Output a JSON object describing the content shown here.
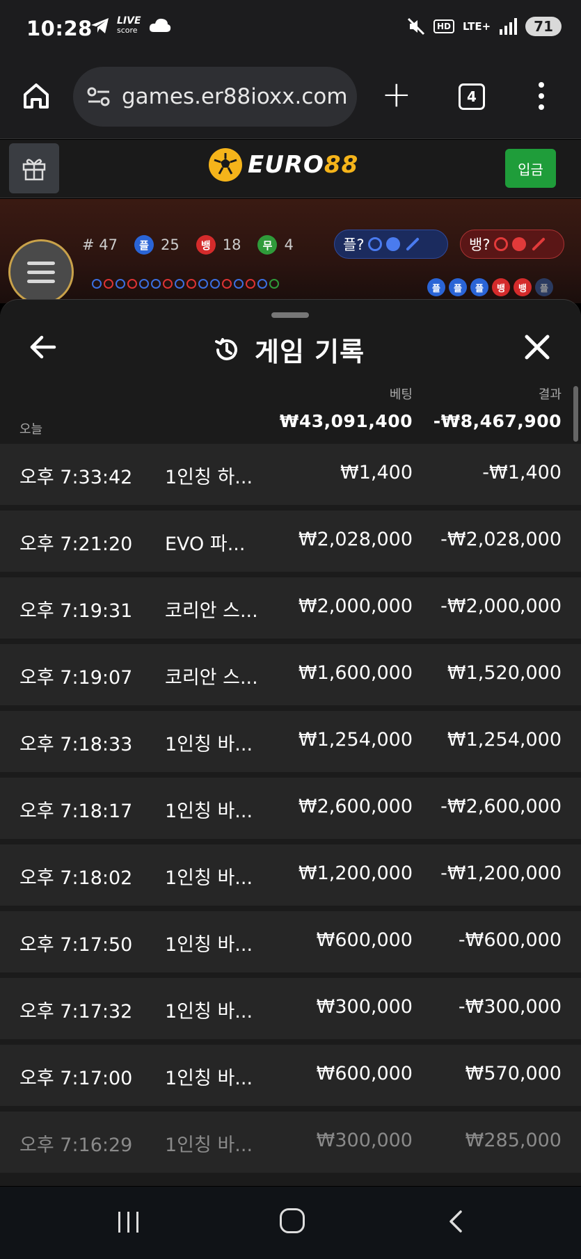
{
  "status_bar": {
    "time": "10:28",
    "live_score_top": "LIVE",
    "live_score_bottom": "score",
    "hd": "HD",
    "network": "LTE+",
    "battery": "71"
  },
  "browser": {
    "url": "games.er88ioxx.com",
    "tab_count": "4"
  },
  "site_header": {
    "logo_primary": "EURO",
    "logo_accent": "88",
    "deposit_label": "입금",
    "accent_color": "#f5b41a",
    "deposit_color": "#1f9d3a"
  },
  "game": {
    "round_label": "# 47",
    "player_chip": "플",
    "player_count": "25",
    "banker_chip": "뱅",
    "banker_count": "18",
    "tie_chip": "무",
    "tie_count": "4",
    "player_predict": "플?",
    "banker_predict": "뱅?",
    "trend": [
      "플",
      "플",
      "플",
      "뱅",
      "뱅",
      "플"
    ]
  },
  "history": {
    "title": "게임 기록",
    "bet_header": "베팅",
    "result_header": "결과",
    "today_label": "오늘",
    "total_bet": "₩43,091,400",
    "total_result": "-₩8,467,900",
    "rows": [
      {
        "time": "오후 7:33:42",
        "game": "1인칭 하...",
        "bet": "₩1,400",
        "result": "-₩1,400"
      },
      {
        "time": "오후 7:21:20",
        "game": "EVO 파...",
        "bet": "₩2,028,000",
        "result": "-₩2,028,000"
      },
      {
        "time": "오후 7:19:31",
        "game": "코리안 스...",
        "bet": "₩2,000,000",
        "result": "-₩2,000,000"
      },
      {
        "time": "오후 7:19:07",
        "game": "코리안 스...",
        "bet": "₩1,600,000",
        "result": "₩1,520,000"
      },
      {
        "time": "오후 7:18:33",
        "game": "1인칭 바...",
        "bet": "₩1,254,000",
        "result": "₩1,254,000"
      },
      {
        "time": "오후 7:18:17",
        "game": "1인칭 바...",
        "bet": "₩2,600,000",
        "result": "-₩2,600,000"
      },
      {
        "time": "오후 7:18:02",
        "game": "1인칭 바...",
        "bet": "₩1,200,000",
        "result": "-₩1,200,000"
      },
      {
        "time": "오후 7:17:50",
        "game": "1인칭 바...",
        "bet": "₩600,000",
        "result": "-₩600,000"
      },
      {
        "time": "오후 7:17:32",
        "game": "1인칭 바...",
        "bet": "₩300,000",
        "result": "-₩300,000"
      },
      {
        "time": "오후 7:17:00",
        "game": "1인칭 바...",
        "bet": "₩600,000",
        "result": "₩570,000"
      },
      {
        "time": "오후 7:16:29",
        "game": "1인칭 바...",
        "bet": "₩300,000",
        "result": "₩285,000"
      }
    ]
  }
}
